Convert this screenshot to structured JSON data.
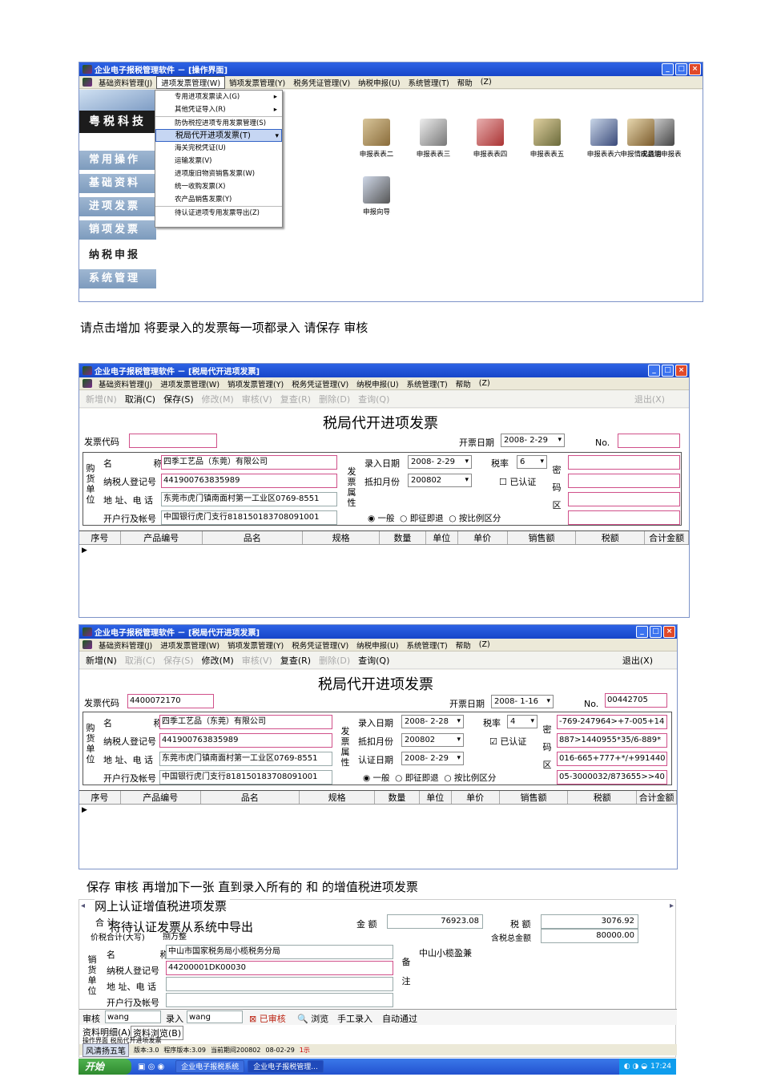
{
  "captions": {
    "step1": "请点击增加 将要录入的发票每一项都录入 请保存 审核",
    "step2": "保存 审核 再增加下一张 直到录入所有的 和 的增值税进项发票",
    "step3": "网上认证增值税进项发票",
    "step4": "将待认证发票从系统中导出"
  },
  "shot1": {
    "title": "企业电子报税管理软件 － [操作界面]",
    "menus": [
      "基础资料管理(J)",
      "进项发票管理(W)",
      "销项发票管理(Y)",
      "税务凭证管理(V)",
      "纳税申报(U)",
      "系统管理(T)",
      "帮助",
      "(Z)"
    ],
    "brand": "粤税科技",
    "side": [
      "常用操作",
      "基础资料",
      "进项发票",
      "销项发票",
      "纳税申报",
      "系统管理"
    ],
    "popup": [
      "专用进项发票读入(G)",
      "其他凭证导入(R)",
      "防伪税控进项专用发票管理(S)",
      "税局代开进项发票(T)",
      "海关完税凭证(U)",
      "运输发票(V)",
      "进项废旧物资销售发票(W)",
      "统一收购发票(X)",
      "农产品销售发票(Y)",
      "待认证进项专用发票导出(Z)"
    ],
    "tools": [
      "申报表表二",
      "申报表表三",
      "申报表表四",
      "申报表表五",
      "申报表表六",
      "成品油申报表",
      "申报情况说明",
      "申报向导"
    ]
  },
  "shot2": {
    "title": "企业电子报税管理软件 － [税局代开进项发票]",
    "menus": [
      "基础资料管理(J)",
      "进项发票管理(W)",
      "销项发票管理(Y)",
      "税务凭证管理(V)",
      "纳税申报(U)",
      "系统管理(T)",
      "帮助",
      "(Z)"
    ],
    "toolbar": [
      "新增(N)",
      "取消(C)",
      "保存(S)",
      "修改(M)",
      "审核(V)",
      "复查(R)",
      "删除(D)",
      "查询(Q)",
      "退出(X)"
    ],
    "form_title": "税局代开进项发票",
    "invoice_code_label": "发票代码",
    "invoice_code": "",
    "issue_date_label": "开票日期",
    "issue_date": "2008- 2-29",
    "no_label": "No.",
    "no": "",
    "buyer_label": "购货单位",
    "name_label": "名 称",
    "name": "四季工艺品（东莞）有限公司",
    "taxid_label": "纳税人登记号",
    "taxid": "441900763835989",
    "addr_label": "地 址、电 话",
    "addr": "东莞市虎门镇南面村第一工业区0769-8551",
    "bank_label": "开户行及帐号",
    "bank": "中国银行虎门支行818150183708091001",
    "attr_label": "发票属性",
    "entry_date_label": "录入日期",
    "entry_date": "2008- 2-29",
    "rate_label": "税率",
    "rate": "6",
    "deduct_label": "抵扣月份",
    "deduct": "200802",
    "certified": "已认证",
    "opts": [
      "一般",
      "即征即退",
      "按比例区分"
    ],
    "secret_label": "密码区",
    "secret": [
      "",
      "",
      "",
      ""
    ],
    "columns": [
      "序号",
      "产品编号",
      "品名",
      "规格",
      "数量",
      "单位",
      "单价",
      "销售额",
      "税额",
      "合计金额"
    ]
  },
  "shot3": {
    "title": "企业电子报税管理软件 － [税局代开进项发票]",
    "toolbar": [
      "新增(N)",
      "取消(C)",
      "保存(S)",
      "修改(M)",
      "审核(V)",
      "复查(R)",
      "删除(D)",
      "查询(Q)",
      "退出(X)"
    ],
    "form_title": "税局代开进项发票",
    "invoice_code": "4400072170",
    "issue_date": "2008- 1-16",
    "no": "00442705",
    "name": "四季工艺品（东莞）有限公司",
    "taxid": "441900763835989",
    "addr": "东莞市虎门镇南面村第一工业区0769-8551",
    "bank": "中国银行虎门支行818150183708091001",
    "entry_date": "2008- 2-28",
    "rate": "4",
    "deduct": "200802",
    "cert_date_label": "认证日期",
    "cert_date": "2008- 2-29",
    "secret": [
      "-769-247964>+7-005+14",
      "887>1440955*35/6-889*",
      "016-665+777+*/+991440",
      "05-3000032/873655>>40"
    ]
  },
  "shot4": {
    "total_label": "合 计",
    "amount_label": "金 额",
    "amount": "76923.08",
    "tax_label": "税 额",
    "tax": "3076.92",
    "big_total_label": "价税合计(大写)",
    "big_total": "捌万整",
    "incl_label": "含税总金额",
    "incl": "80000.00",
    "seller_label": "销货单位",
    "name_label": "名 称",
    "seller_name": "中山市国家税务局小榄税务分局",
    "taxid_label": "纳税人登记号",
    "seller_taxid": "44200001DK00030",
    "addr_label": "地 址、电 话",
    "bank_label": "开户行及帐号",
    "remark_label": "备注",
    "remark": "中山小榄盈兼",
    "audit_label": "审核",
    "auditor": "wang",
    "enter_label": "录入",
    "enterer": "wang",
    "btn_audited": "已审核",
    "btn_browse": "浏览",
    "btn_manual": "手工录入",
    "btn_auto": "自动通过",
    "tabs": [
      "资料明细(A)",
      "资料浏览(B)"
    ],
    "subtab": "操作界面 税局代开进项发票",
    "ime": "风清扬五笔",
    "status": [
      "版本:3.0",
      "程序版本:3.09",
      "当前期间200802",
      "08-02-29",
      "1示"
    ],
    "start": "开始",
    "tasks": [
      "企业电子报税系统",
      "企业电子报税管理..."
    ],
    "clock": "17:24"
  }
}
